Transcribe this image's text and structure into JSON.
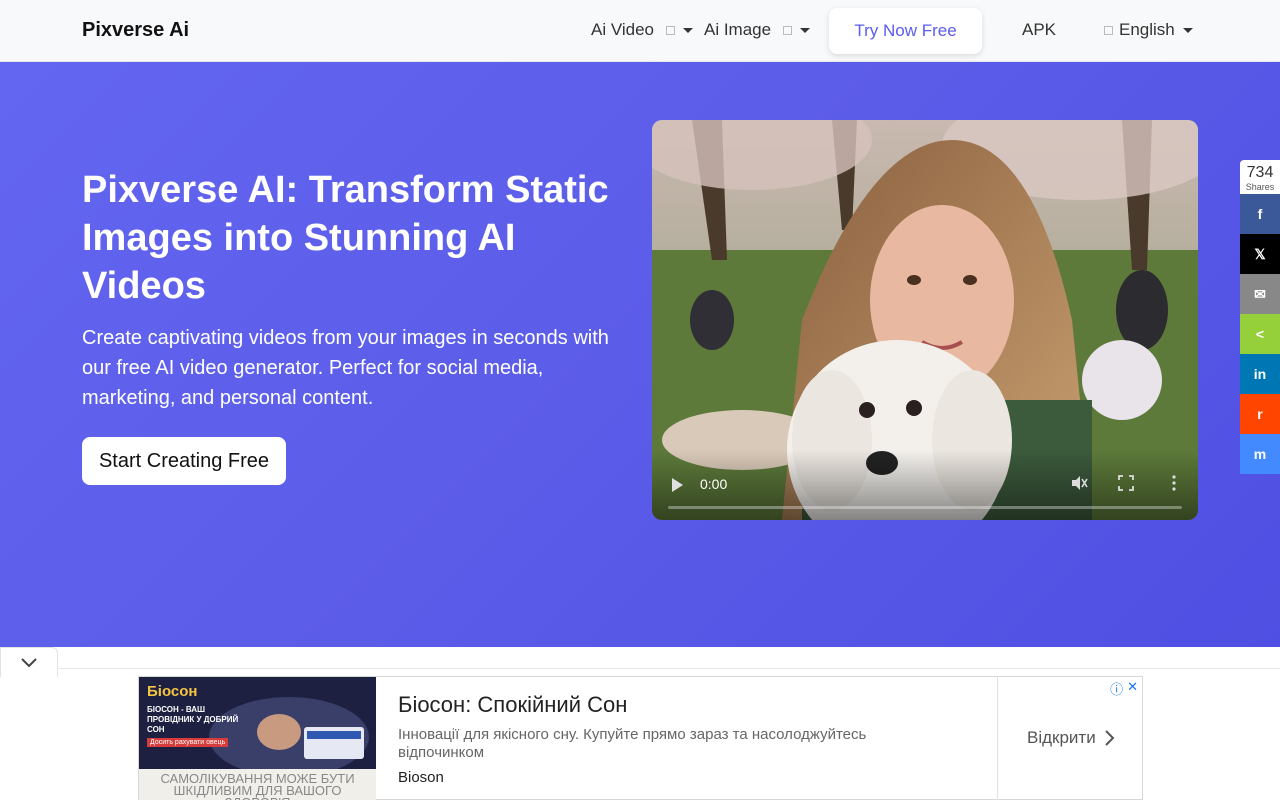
{
  "nav": {
    "brand": "Pixverse Ai",
    "items": [
      {
        "label": "Ai Video"
      },
      {
        "label": "Ai Image"
      }
    ],
    "try_label": "Try Now Free",
    "apk_label": "APK",
    "lang_label": "English"
  },
  "hero": {
    "title": "Pixverse AI: Transform Static Images into Stunning AI Videos",
    "subtitle": "Create captivating videos from your images in seconds with our free AI video generator. Perfect for social media, marketing, and personal content.",
    "cta_label": "Start Creating Free",
    "video_time": "0:00",
    "video_progress": 0
  },
  "share": {
    "count": "734",
    "count_label": "Shares",
    "buttons": [
      {
        "name": "facebook",
        "glyph": "f",
        "color": "#3b5998"
      },
      {
        "name": "x",
        "glyph": "𝕏",
        "color": "#000000"
      },
      {
        "name": "email",
        "glyph": "✉",
        "color": "#888888"
      },
      {
        "name": "sharethis",
        "glyph": "<",
        "color": "#95d03a"
      },
      {
        "name": "linkedin",
        "glyph": "in",
        "color": "#0077b5"
      },
      {
        "name": "reddit",
        "glyph": "r",
        "color": "#ff4500"
      },
      {
        "name": "messenger",
        "glyph": "m",
        "color": "#448aff"
      }
    ]
  },
  "ad": {
    "title": "Біосон: Спокійний Сон",
    "description": "Інновації для якісного сну. Купуйте прямо зараз та насолоджуйтесь відпочинком",
    "brand": "Bioson",
    "open_label": "Відкрити",
    "image_logo": "Біосон",
    "image_text": "БІОСОН - ВАШ ПРОВІДНИК У ДОБРИЙ СОН",
    "image_badge": "Досить рахувати овець",
    "image_footer": "САМОЛІКУВАННЯ МОЖЕ БУТИ ШКІДЛИВИМ ДЛЯ ВАШОГО ЗДОРОВ'Я"
  },
  "colors": {
    "hero_start": "#6366f1",
    "hero_end": "#4f4fe3",
    "accent": "#5b5cf0"
  }
}
